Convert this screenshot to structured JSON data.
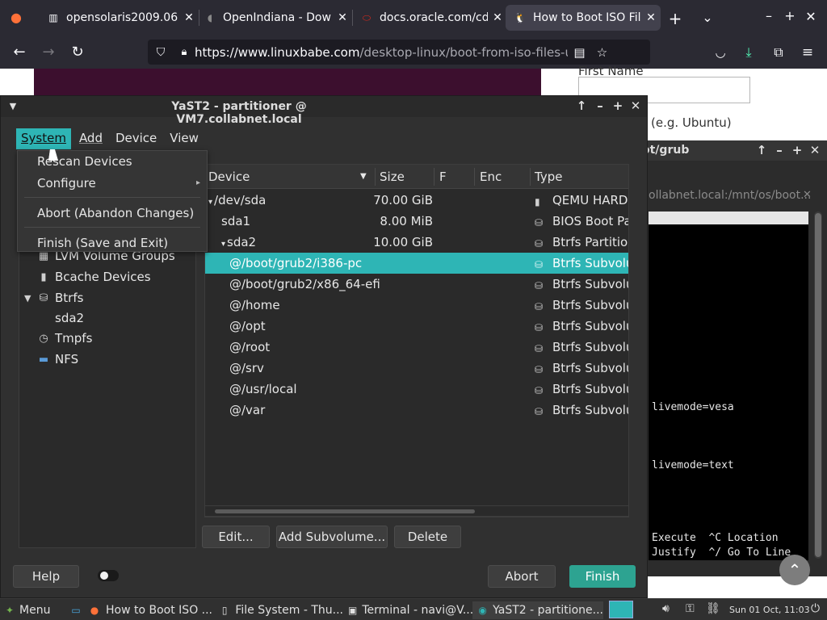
{
  "browser": {
    "tabs": [
      {
        "title": "opensolaris2009.06",
        "favicon": "server-icon",
        "active": false
      },
      {
        "title": "OpenIndiana - Dow",
        "favicon": "openindiana-icon",
        "active": false
      },
      {
        "title": "docs.oracle.com/cd",
        "favicon": "oracle-icon",
        "active": false
      },
      {
        "title": "How to Boot ISO Fil",
        "favicon": "tux-icon",
        "active": true
      }
    ],
    "url_host": "https://www.linuxbabe.com",
    "url_path": "/desktop-linux/boot-from-iso-files-using-g"
  },
  "webpage": {
    "label": "First Name",
    "text": "(e.g. Ubuntu)"
  },
  "terminal": {
    "title": "ot/grub",
    "tab_label": "ollabnet.local:/mnt/os/boot...",
    "lines": [
      {
        "text": "livemode=vesa"
      },
      {
        "text": "livemode=text"
      },
      {
        "text": "Execute  ^C Location"
      },
      {
        "text": "Justify  ^/ Go To Line"
      }
    ]
  },
  "yast": {
    "title": "YaST2 - partitioner @ VM7.collabnet.local",
    "menu": [
      "System",
      "Add",
      "Device",
      "View"
    ],
    "dropdown": [
      "Rescan Devices",
      "Configure",
      "Abort (Abandon Changes)",
      "Finish (Save and Exit)"
    ],
    "tree": [
      {
        "label": "LVM Volume Groups",
        "icon": "lvm-icon"
      },
      {
        "label": "Bcache Devices",
        "icon": "bcache-icon"
      },
      {
        "label": "Btrfs",
        "icon": "btrfs-icon"
      },
      {
        "label": "sda2",
        "icon": ""
      },
      {
        "label": "Tmpfs",
        "icon": "tmpfs-icon"
      },
      {
        "label": "NFS",
        "icon": "nfs-icon"
      }
    ],
    "columns": [
      "Device",
      "Size",
      "F",
      "Enc",
      "Type"
    ],
    "rows": [
      {
        "device": "/dev/sda",
        "size": "70.00 GiB",
        "type": "QEMU HARDD",
        "indent": 0,
        "expander": "▾",
        "selected": false
      },
      {
        "device": "sda1",
        "size": "8.00 MiB",
        "type": "BIOS Boot Par",
        "indent": 1,
        "expander": "",
        "selected": false
      },
      {
        "device": "sda2",
        "size": "10.00 GiB",
        "type": "Btrfs Partition",
        "indent": 1,
        "expander": "▾",
        "selected": false
      },
      {
        "device": "@/boot/grub2/i386-pc",
        "size": "",
        "type": "Btrfs Subvolu",
        "indent": 2,
        "expander": "",
        "selected": true
      },
      {
        "device": "@/boot/grub2/x86_64-efi",
        "size": "",
        "type": "Btrfs Subvolu",
        "indent": 2,
        "expander": "",
        "selected": false
      },
      {
        "device": "@/home",
        "size": "",
        "type": "Btrfs Subvolu",
        "indent": 2,
        "expander": "",
        "selected": false
      },
      {
        "device": "@/opt",
        "size": "",
        "type": "Btrfs Subvolu",
        "indent": 2,
        "expander": "",
        "selected": false
      },
      {
        "device": "@/root",
        "size": "",
        "type": "Btrfs Subvolu",
        "indent": 2,
        "expander": "",
        "selected": false
      },
      {
        "device": "@/srv",
        "size": "",
        "type": "Btrfs Subvolu",
        "indent": 2,
        "expander": "",
        "selected": false
      },
      {
        "device": "@/usr/local",
        "size": "",
        "type": "Btrfs Subvolu",
        "indent": 2,
        "expander": "",
        "selected": false
      },
      {
        "device": "@/var",
        "size": "",
        "type": "Btrfs Subvolu",
        "indent": 2,
        "expander": "",
        "selected": false
      }
    ],
    "buttons": {
      "edit": "Edit...",
      "add_subvolume": "Add Subvolume...",
      "delete": "Delete",
      "help": "Help",
      "abort": "Abort",
      "finish": "Finish"
    }
  },
  "taskbar": {
    "menu": "Menu",
    "tasks": [
      {
        "label": "How to Boot ISO ...",
        "icon": "firefox-icon",
        "active": false
      },
      {
        "label": "File System - Thu...",
        "icon": "file-manager-icon",
        "active": false
      },
      {
        "label": "Terminal - navi@V...",
        "icon": "terminal-icon",
        "active": false
      },
      {
        "label": "YaST2 - partitione...",
        "icon": "yast-icon",
        "active": true
      }
    ],
    "clock": "Sun 01 Oct, 11:03"
  },
  "colors": {
    "accent": "#2eb5b5",
    "finish_button": "#2da391",
    "window_bg": "#303030",
    "browser_chrome": "#2b2a33"
  }
}
